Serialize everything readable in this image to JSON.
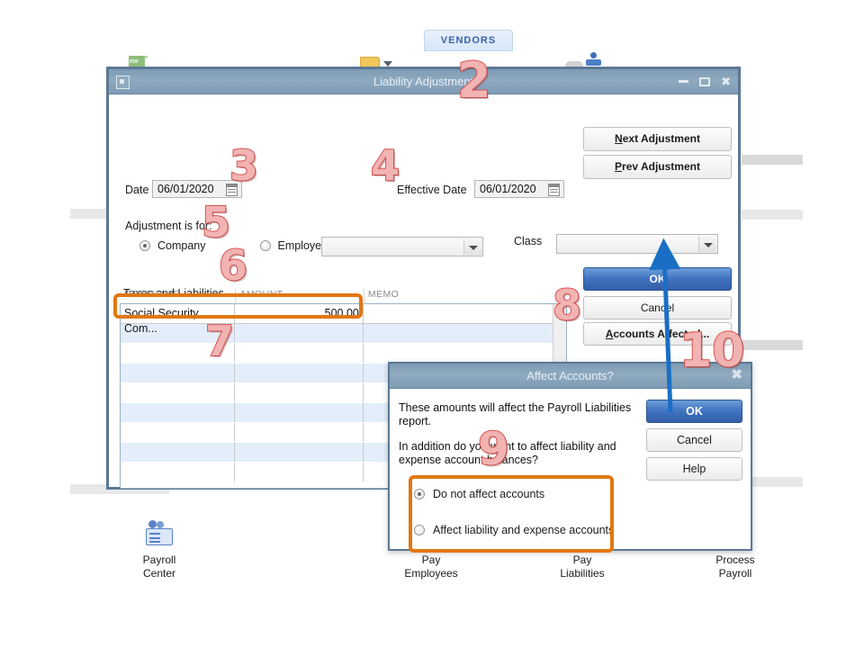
{
  "background": {
    "vendors_tab_label": "VENDORS",
    "icons": [
      "pdf-icon",
      "folder-icon",
      "chevron-down-icon",
      "cloud-icon",
      "person-icon"
    ]
  },
  "main_window": {
    "title": "Liability Adjustment",
    "window_controls": {
      "minimize": "minimize-icon",
      "maximize": "maximize-icon",
      "close": "✖"
    },
    "buttons": {
      "next_adjustment": {
        "accel": "N",
        "rest": "ext Adjustment"
      },
      "prev_adjustment": {
        "accel": "P",
        "rest": "rev Adjustment"
      },
      "ok": "OK",
      "cancel": "Cancel",
      "accounts_affected": {
        "accel": "A",
        "rest": "ccounts Affected..."
      }
    },
    "date_label": "Date",
    "date_value": "06/01/2020",
    "effective_date_label": "Effective Date",
    "effective_date_value": "06/01/2020",
    "adjustment_for_label": "Adjustment is for:",
    "radio_company": "Company",
    "radio_employee": "Employee",
    "radio_selected": "Company",
    "employee_combo_value": "",
    "class_label": "Class",
    "class_combo_value": "",
    "taxes_label": "Taxes and Liabilities",
    "grid": {
      "columns": [
        "ITEM NAME",
        "AMOUNT",
        "MEMO"
      ],
      "rows": [
        {
          "item": "Social Security Com...",
          "amount": "500.00",
          "memo": ""
        },
        {
          "item": "",
          "amount": "",
          "memo": ""
        },
        {
          "item": "",
          "amount": "",
          "memo": ""
        },
        {
          "item": "",
          "amount": "",
          "memo": ""
        },
        {
          "item": "",
          "amount": "",
          "memo": ""
        },
        {
          "item": "",
          "amount": "",
          "memo": ""
        },
        {
          "item": "",
          "amount": "",
          "memo": ""
        },
        {
          "item": "",
          "amount": "",
          "memo": ""
        },
        {
          "item": "",
          "amount": "",
          "memo": ""
        }
      ]
    }
  },
  "dialog": {
    "title": "Affect Accounts?",
    "close": "✖",
    "text_1": "These amounts will affect the Payroll Liabilities report.",
    "text_2": "In addition do you want to affect liability and expense account balances?",
    "radio_1": "Do not affect accounts",
    "radio_2": "Affect liability and expense accounts",
    "radio_selected": "Do not affect accounts",
    "buttons": {
      "ok": "OK",
      "cancel": "Cancel",
      "help": "Help"
    }
  },
  "footer": {
    "items": [
      {
        "line1": "Payroll",
        "line2": "Center"
      },
      {
        "line1": "Pay",
        "line2": "Employees"
      },
      {
        "line1": "Pay",
        "line2": "Liabilities"
      },
      {
        "line1": "Process",
        "line2": "Payroll"
      }
    ]
  },
  "annotations": {
    "n2": "2",
    "n3": "3",
    "n4": "4",
    "n5": "5",
    "n6": "6",
    "n7": "7",
    "n8": "8",
    "n9": "9",
    "n10": "10"
  },
  "colors": {
    "accent_blue": "#3f72c0",
    "titlebar": "#8fa9bf",
    "highlight_orange": "#e2770f",
    "annotation_red": "#d9534f",
    "row_alt": "#e4eefb"
  }
}
